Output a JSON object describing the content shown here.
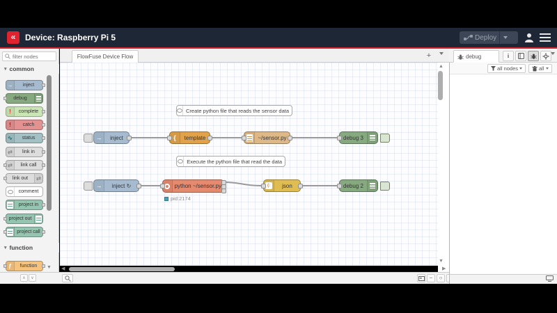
{
  "header": {
    "title": "Device: Raspberry Pi 5",
    "deploy": {
      "label": "Deploy"
    },
    "brand_color": "#e0232e",
    "bg_color": "#1e2736"
  },
  "palette": {
    "filter_placeholder": "filter nodes",
    "categories": [
      {
        "label": "common",
        "nodes": [
          {
            "label": "inject",
            "color": "#a6bbcf",
            "icon": "inject-arrow-icon"
          },
          {
            "label": "debug",
            "color": "#87a980",
            "icon": "debug-sidebar-icon"
          },
          {
            "label": "complete",
            "color": "#cbe6b5",
            "icon": "exclamation-icon"
          },
          {
            "label": "catch",
            "color": "#e49191",
            "icon": "exclamation-icon"
          },
          {
            "label": "status",
            "color": "#a3c1c4",
            "icon": "heartbeat-icon"
          },
          {
            "label": "link in",
            "color": "#dddddd",
            "icon": "link-icon"
          },
          {
            "label": "link call",
            "color": "#dddddd",
            "icon": "link-icon"
          },
          {
            "label": "link out",
            "color": "#dddddd",
            "icon": "link-icon"
          },
          {
            "label": "comment",
            "color": "#ffffff",
            "icon": "comment-bubble-icon"
          },
          {
            "label": "project in",
            "color": "#95c5b0",
            "icon": "project-icon"
          },
          {
            "label": "project out",
            "color": "#95c5b0",
            "icon": "project-icon"
          },
          {
            "label": "project call",
            "color": "#95c5b0",
            "icon": "project-icon"
          }
        ]
      },
      {
        "label": "function",
        "nodes": [
          {
            "label": "function",
            "color": "#f5c37e",
            "icon": "function-f-icon"
          }
        ]
      }
    ]
  },
  "workspace": {
    "tabs": [
      {
        "label": "FlowFuse Device Flow",
        "active": true
      }
    ],
    "comments": [
      {
        "text": "Create python file that reads the sensor data"
      },
      {
        "text": "Execute the python file that read the data"
      }
    ],
    "nodes": [
      {
        "label": "inject",
        "type": "inject",
        "color": "#a6bbcf"
      },
      {
        "label": "template",
        "type": "template",
        "color": "#e2a249"
      },
      {
        "label": "~/sensor.py",
        "type": "file",
        "color": "#deb887"
      },
      {
        "label": "debug 3",
        "type": "debug",
        "color": "#87a980"
      },
      {
        "label": "inject ↻",
        "type": "inject",
        "color": "#a6bbcf"
      },
      {
        "label": "python ~/sensor.py",
        "type": "exec",
        "color": "#e58a6f"
      },
      {
        "label": "json",
        "type": "json",
        "color": "#dfbd52"
      },
      {
        "label": "debug 2",
        "type": "debug",
        "color": "#87a980"
      }
    ],
    "status_text": "pid:2174",
    "status_color": "#4aa0b5",
    "wire_color": "#999999"
  },
  "sidebar": {
    "tab_label": "debug",
    "filter_nodes_label": "all nodes",
    "clear_label": "all"
  }
}
